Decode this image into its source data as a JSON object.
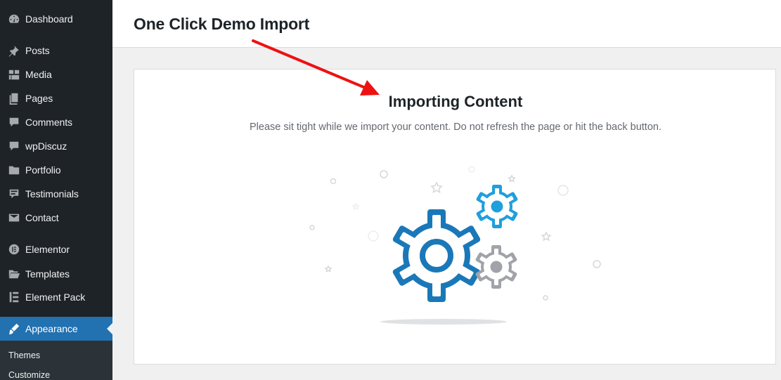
{
  "sidebar": {
    "items": [
      {
        "label": "Dashboard",
        "icon": "dashboard-icon"
      },
      {
        "label": "Posts",
        "icon": "pin-icon"
      },
      {
        "label": "Media",
        "icon": "media-icon"
      },
      {
        "label": "Pages",
        "icon": "pages-icon"
      },
      {
        "label": "Comments",
        "icon": "comment-icon"
      },
      {
        "label": "wpDiscuz",
        "icon": "comment-icon"
      },
      {
        "label": "Portfolio",
        "icon": "folder-icon"
      },
      {
        "label": "Testimonials",
        "icon": "testimonial-icon"
      },
      {
        "label": "Contact",
        "icon": "mail-icon"
      },
      {
        "label": "Elementor",
        "icon": "elementor-icon"
      },
      {
        "label": "Templates",
        "icon": "folder-open-icon"
      },
      {
        "label": "Element Pack",
        "icon": "element-pack-icon"
      },
      {
        "label": "Appearance",
        "icon": "brush-icon"
      }
    ],
    "submenu": [
      "Themes",
      "Customize"
    ],
    "active_color": "#2271b1"
  },
  "header": {
    "title": "One Click Demo Import"
  },
  "card": {
    "title": "Importing Content",
    "description": "Please sit tight while we import your content. Do not refresh the page or hit the back button."
  },
  "colors": {
    "gear_dark": "#1a78b8",
    "gear_light": "#1ea0dc",
    "gear_gray": "#a0a3a8",
    "arrow": "#ee1111"
  }
}
